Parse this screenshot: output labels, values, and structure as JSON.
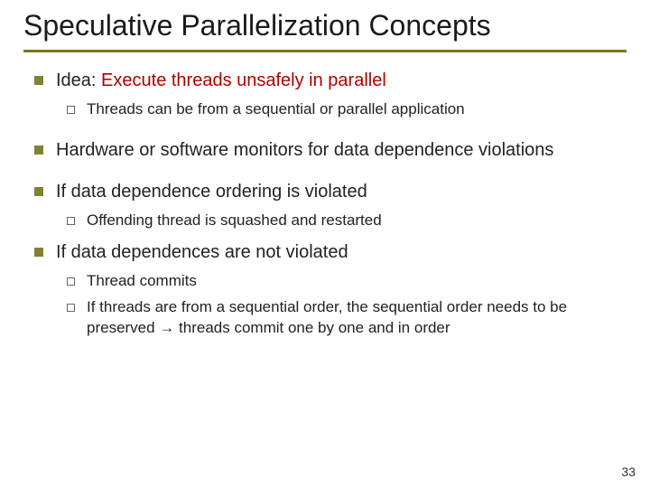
{
  "title": "Speculative Parallelization Concepts",
  "bullets": {
    "b1_prefix": "Idea: ",
    "b1_red": "Execute threads unsafely in parallel",
    "b1_sub1": "Threads can be from a sequential or parallel application",
    "b2": "Hardware or software monitors for data dependence violations",
    "b3": "If data dependence ordering is violated",
    "b3_sub1": "Offending thread is squashed and restarted",
    "b4": "If data dependences are not violated",
    "b4_sub1": "Thread commits",
    "b4_sub2": "If threads are from a sequential order, the sequential order needs to be preserved → threads commit one by one and in order"
  },
  "page_number": "33"
}
